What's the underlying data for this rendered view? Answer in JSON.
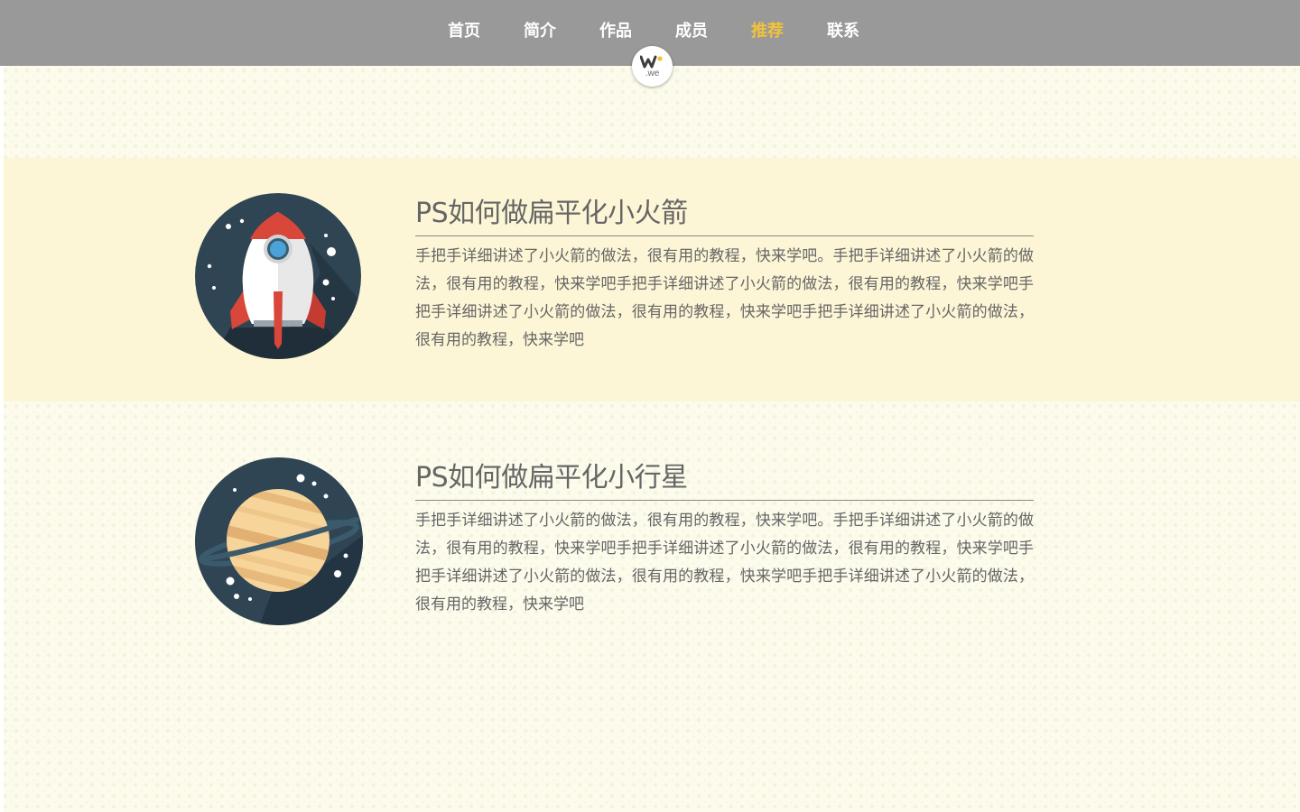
{
  "nav": {
    "items": [
      {
        "label": "首页"
      },
      {
        "label": "简介"
      },
      {
        "label": "作品"
      },
      {
        "label": "成员"
      },
      {
        "label": "推荐"
      },
      {
        "label": "联系"
      }
    ],
    "active_index": 4,
    "active_color": "#f2c23c",
    "bar_color": "#999999"
  },
  "logo": {
    "text": ".we",
    "icon": "w-logo-icon"
  },
  "articles": [
    {
      "title": "PS如何做扁平化小火箭",
      "body": "手把手详细讲述了小火箭的做法，很有用的教程，快来学吧。手把手详细讲述了小火箭的做法，很有用的教程，快来学吧手把手详细讲述了小火箭的做法，很有用的教程，快来学吧手把手详细讲述了小火箭的做法，很有用的教程，快来学吧手把手详细讲述了小火箭的做法，很有用的教程，快来学吧",
      "icon": "rocket-icon"
    },
    {
      "title": "PS如何做扁平化小行星",
      "body": "手把手详细讲述了小火箭的做法，很有用的教程，快来学吧。手把手详细讲述了小火箭的做法，很有用的教程，快来学吧手把手详细讲述了小火箭的做法，很有用的教程，快来学吧手把手详细讲述了小火箭的做法，很有用的教程，快来学吧手把手详细讲述了小火箭的做法，很有用的教程，快来学吧",
      "icon": "planet-icon"
    }
  ],
  "colors": {
    "page_bg": "#fcfbec",
    "band_bg": "#fdf6d6",
    "text": "#666666",
    "icon_bg": "#2f4553"
  }
}
